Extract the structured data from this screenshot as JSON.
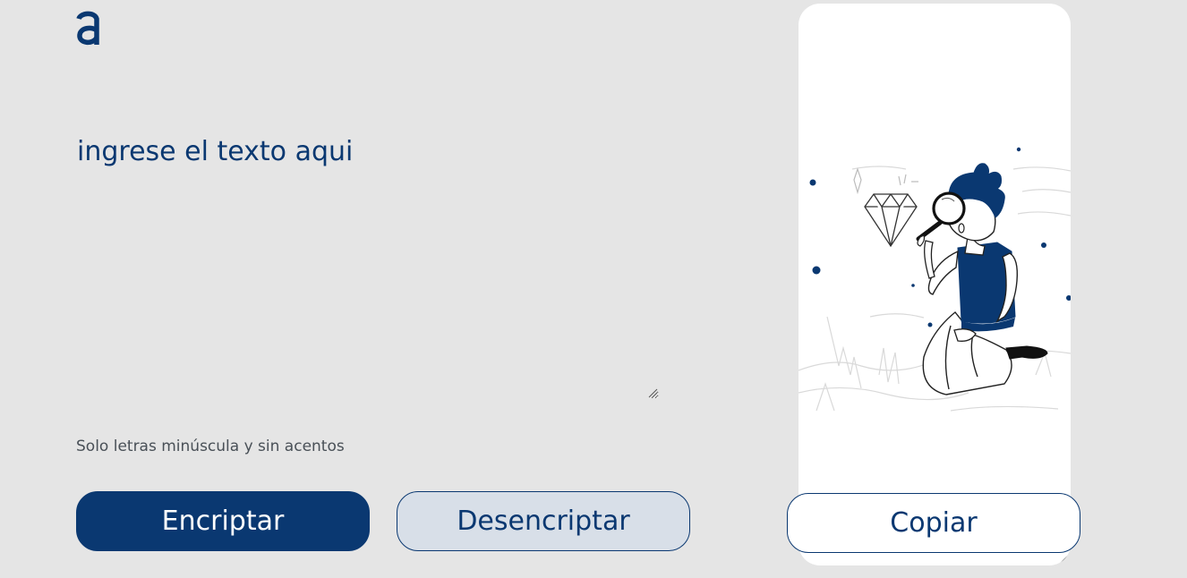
{
  "input": {
    "placeholder": "ingrese el texto aqui",
    "value": ""
  },
  "hint": {
    "text": "Solo letras minúscula y sin acentos"
  },
  "buttons": {
    "encrypt_label": "Encriptar",
    "decrypt_label": "Desencriptar",
    "copy_label": "Copiar"
  },
  "icons": {
    "logo": "alura-logo",
    "illustration": "person-with-magnifying-glass-illustration"
  },
  "colors": {
    "background": "#e5e5e5",
    "primary": "#0a3871",
    "secondary_button_bg": "#d8dfe8",
    "panel": "#ffffff",
    "hint_text": "#495057"
  }
}
